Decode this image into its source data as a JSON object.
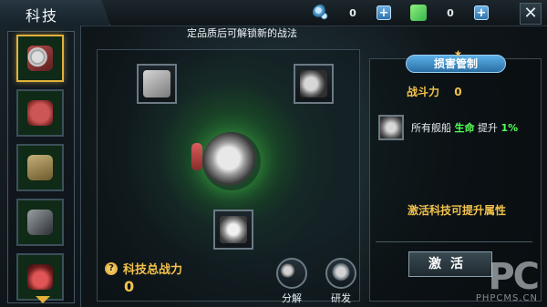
{
  "header": {
    "title": "科技",
    "currency_1_value": "0",
    "currency_2_value": "0",
    "plus_label": "+",
    "close_label": "✕"
  },
  "left_sidebar": {
    "items": [
      {
        "icon": "gear-icon"
      },
      {
        "icon": "tank-icon"
      },
      {
        "icon": "armor-icon"
      },
      {
        "icon": "cannon-icon"
      },
      {
        "icon": "fire-icon"
      }
    ],
    "selected_index": 0,
    "scroll_hint": "▼"
  },
  "main": {
    "hint": "定品质后可解锁新的战法",
    "total_power_label": "科技总战力",
    "total_power_value": "0",
    "actions": [
      {
        "label": "分解"
      },
      {
        "label": "研发"
      }
    ]
  },
  "details": {
    "title": "损害管制",
    "power_label": "战斗力",
    "power_value": "0",
    "effect_prefix": "所有舰船",
    "effect_highlight": "生命",
    "effect_suffix": "提升",
    "effect_value": "1%",
    "activate_hint": "激活科技可提升属性",
    "activate_button": "激活"
  },
  "watermark": {
    "big": "PC",
    "small": "PHPCMS.CN"
  }
}
